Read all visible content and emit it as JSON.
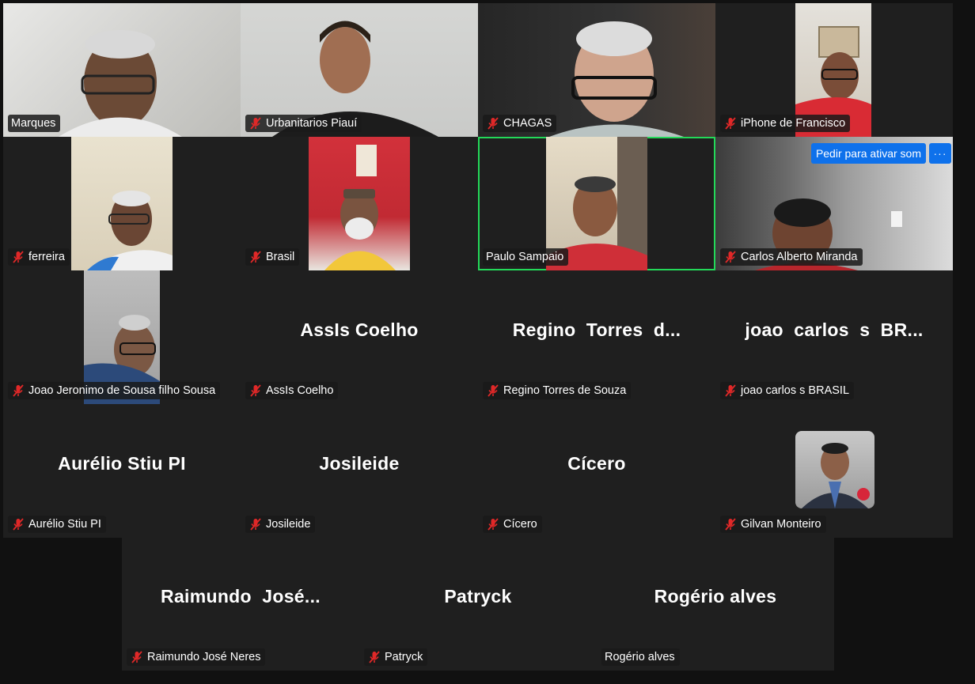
{
  "participants": [
    {
      "label": "Marques",
      "muted": false
    },
    {
      "label": "Urbanitarios Piauí",
      "muted": true
    },
    {
      "label": "CHAGAS",
      "muted": true
    },
    {
      "label": "iPhone de Francisco",
      "muted": true
    },
    {
      "label": "ferreira",
      "muted": true
    },
    {
      "label": "Brasil",
      "muted": true
    },
    {
      "label": "Paulo Sampaio",
      "muted": false,
      "active_speaker": true
    },
    {
      "label": "Carlos Alberto Miranda",
      "muted": true
    },
    {
      "label": "Joao Jeronimo de Sousa filho Sousa",
      "muted": true
    },
    {
      "label": "AssIs Coelho",
      "display": "AssIs Coelho",
      "muted": true
    },
    {
      "label": "Regino Torres de Souza",
      "display": "Regino  Torres  d...",
      "muted": true
    },
    {
      "label": "joao carlos s BRASIL",
      "display": "joao  carlos  s  BR...",
      "muted": true
    },
    {
      "label": "Aurélio Stiu PI",
      "display": "Aurélio Stiu PI",
      "muted": true
    },
    {
      "label": "Josileide",
      "display": "Josileide",
      "muted": true
    },
    {
      "label": "Cícero",
      "display": "Cícero",
      "muted": true
    },
    {
      "label": "Gilvan Monteiro",
      "muted": true
    },
    {
      "label": "Raimundo José Neres",
      "display": "Raimundo  José...",
      "muted": true
    },
    {
      "label": "Patryck",
      "display": "Patryck",
      "muted": true
    },
    {
      "label": "Rogério alves",
      "display": "Rogério alves",
      "muted": false
    }
  ],
  "actions": {
    "ask_unmute": "Pedir para ativar som",
    "more": "···"
  },
  "colors": {
    "background": "#111111",
    "tile": "#1f1f1f",
    "active_speaker_border": "#23d959",
    "accent_button": "#0e71eb",
    "muted_icon": "#e02828"
  }
}
